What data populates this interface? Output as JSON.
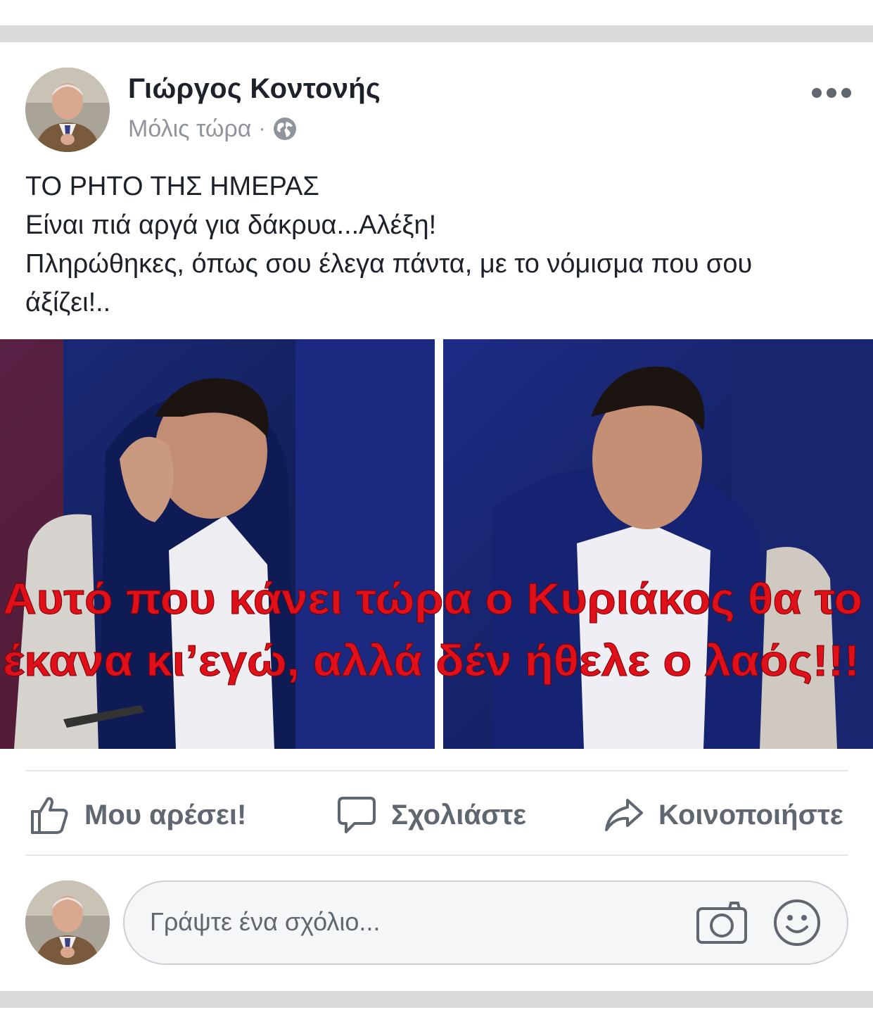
{
  "post": {
    "author": "Γιώργος Κοντονής",
    "timestamp": "Μόλις τώρα",
    "separator": "·",
    "privacy_icon": "globe-icon",
    "more_icon": "more-options-icon",
    "text_lines": [
      "ΤΟ ΡΗΤΟ ΤΗΣ ΗΜΕΡΑΣ",
      "Είναι πιά αργά για δάκρυα...Αλέξη!",
      "Πληρώθηκες, όπως σου έλεγα πάντα, με το νόμισμα που σου",
      "άξίζει!.."
    ],
    "image_caption_lines": [
      "Αυτό που κάνει τώρα ο Κυριάκος θα το",
      "έκανα κι’εγώ, αλλά δέν ήθελε ο λαός!!!"
    ]
  },
  "actions": {
    "like_label": "Μου αρέσει!",
    "comment_label": "Σχολιάστε",
    "share_label": "Κοινοποιήστε"
  },
  "comment_input": {
    "placeholder": "Γράψτε ένα σχόλιο...",
    "camera_icon": "camera-icon",
    "emoji_icon": "smiley-icon"
  },
  "colors": {
    "text_primary": "#1d2129",
    "text_secondary": "#90949c",
    "action_gray": "#606770",
    "caption_red": "#e0101a",
    "divider": "#e5e6e9"
  }
}
